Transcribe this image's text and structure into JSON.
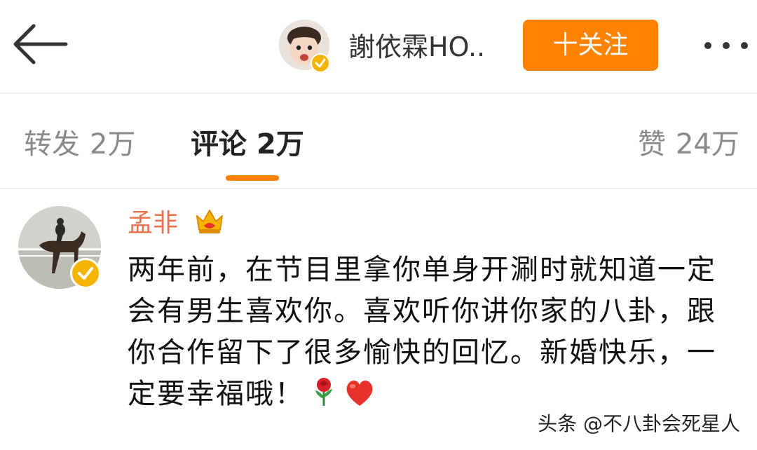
{
  "header": {
    "user_name": "謝依霖HO..",
    "follow_label": "十关注",
    "avatar": "child-avatar",
    "verified": true
  },
  "tabs": [
    {
      "label": "转发",
      "count": "2万",
      "active": false
    },
    {
      "label": "评论",
      "count": "2万",
      "active": true
    },
    {
      "label": "赞",
      "count": "24万",
      "active": false
    }
  ],
  "comment": {
    "author": "孟非",
    "author_badge": "crown-icon",
    "verified": true,
    "text": "两年前，在节目里拿你单身开涮时就知道一定会有男生喜欢你。喜欢听你讲你家的八卦，跟你合作留下了很多愉快的回忆。新婚快乐，一定要幸福哦！",
    "emojis": [
      "rose-icon",
      "heart-icon"
    ]
  },
  "watermark": "头条 @不八卦会死星人",
  "colors": {
    "accent": "#ff8200",
    "author": "#eb7350",
    "verify": "#f5b400",
    "heart": "#e8312a"
  }
}
